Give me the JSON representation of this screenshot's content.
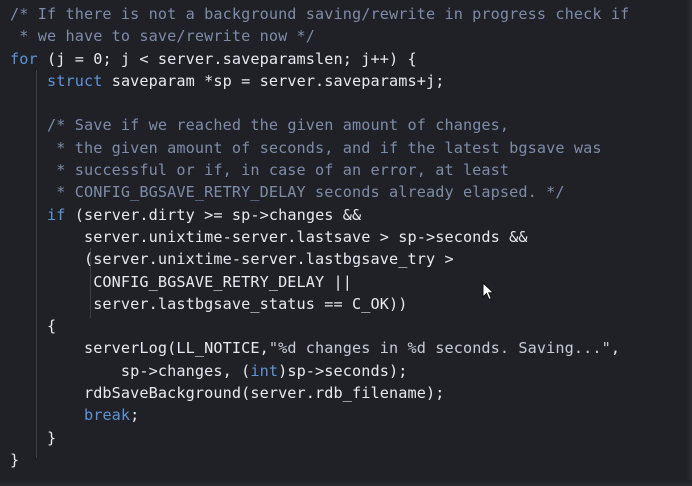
{
  "editor": {
    "lines": [
      [
        {
          "cls": "c",
          "text": "/* If there is not a background saving/rewrite in progress check if"
        }
      ],
      [
        {
          "cls": "c",
          "text": " * we have to save/rewrite now */"
        }
      ],
      [
        {
          "cls": "k",
          "text": "for"
        },
        {
          "cls": "t",
          "text": " (j = 0; j < server.saveparamslen; j++) {"
        }
      ],
      [
        {
          "cls": "t",
          "text": "    "
        },
        {
          "cls": "k",
          "text": "struct"
        },
        {
          "cls": "t",
          "text": " saveparam *sp = server.saveparams+j;"
        }
      ],
      [
        {
          "cls": "t",
          "text": ""
        }
      ],
      [
        {
          "cls": "t",
          "text": "    "
        },
        {
          "cls": "c",
          "text": "/* Save if we reached the given amount of changes,"
        }
      ],
      [
        {
          "cls": "c",
          "text": "     * the given amount of seconds, and if the latest bgsave was"
        }
      ],
      [
        {
          "cls": "c",
          "text": "     * successful or if, in case of an error, at least"
        }
      ],
      [
        {
          "cls": "c",
          "text": "     * CONFIG_BGSAVE_RETRY_DELAY seconds already elapsed. */"
        }
      ],
      [
        {
          "cls": "t",
          "text": "    "
        },
        {
          "cls": "k",
          "text": "if"
        },
        {
          "cls": "t",
          "text": " (server.dirty >= sp->changes &&"
        }
      ],
      [
        {
          "cls": "t",
          "text": "        server.unixtime-server.lastsave > sp->seconds &&"
        }
      ],
      [
        {
          "cls": "t",
          "text": "        (server.unixtime-server.lastbgsave_try >"
        }
      ],
      [
        {
          "cls": "t",
          "text": "         CONFIG_BGSAVE_RETRY_DELAY ||"
        }
      ],
      [
        {
          "cls": "t",
          "text": "         server.lastbgsave_status == C_OK))"
        }
      ],
      [
        {
          "cls": "t",
          "text": "    {"
        }
      ],
      [
        {
          "cls": "t",
          "text": "        serverLog(LL_NOTICE,"
        },
        {
          "cls": "s",
          "text": "\"%d changes in %d seconds. Saving...\""
        },
        {
          "cls": "t",
          "text": ","
        }
      ],
      [
        {
          "cls": "t",
          "text": "            sp->changes, ("
        },
        {
          "cls": "k",
          "text": "int"
        },
        {
          "cls": "t",
          "text": ")sp->seconds);"
        }
      ],
      [
        {
          "cls": "t",
          "text": "        rdbSaveBackground(server.rdb_filename);"
        }
      ],
      [
        {
          "cls": "t",
          "text": "        "
        },
        {
          "cls": "k",
          "text": "break"
        },
        {
          "cls": "t",
          "text": ";"
        }
      ],
      [
        {
          "cls": "t",
          "text": "    }"
        }
      ],
      [
        {
          "cls": "t",
          "text": "}"
        }
      ]
    ]
  },
  "colors": {
    "background": "#1f2127",
    "comment": "#7f8ba8",
    "keyword": "#5f93d6",
    "text": "#e6e9ef"
  },
  "icons": {
    "cursor": "mouse-pointer-icon"
  }
}
